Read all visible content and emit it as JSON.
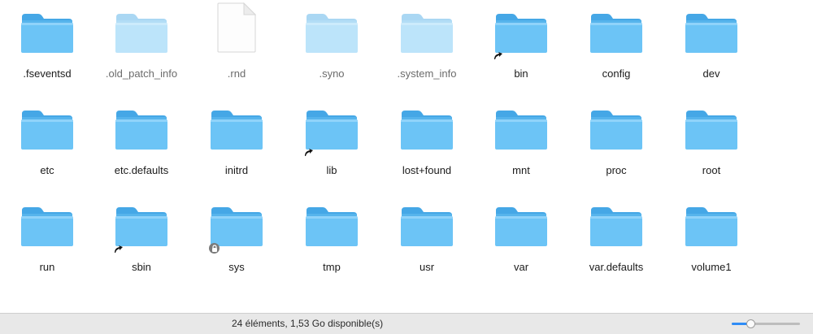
{
  "colors": {
    "folder_front": "#6cc4f6",
    "folder_back": "#56b4ec",
    "folder_tab": "#45a7e6",
    "dim_label": "#6b6b6b",
    "status_bg": "#e8e8e8",
    "accent": "#2f8cf6"
  },
  "items": [
    {
      "name": ".fseventsd",
      "icon": "folder-icon",
      "dimmed": false,
      "badge": null
    },
    {
      "name": ".old_patch_info",
      "icon": "folder-icon",
      "dimmed": true,
      "badge": null
    },
    {
      "name": ".rnd",
      "icon": "document-icon",
      "dimmed": true,
      "badge": null
    },
    {
      "name": ".syno",
      "icon": "folder-icon",
      "dimmed": true,
      "badge": null
    },
    {
      "name": ".system_info",
      "icon": "folder-icon",
      "dimmed": true,
      "badge": null
    },
    {
      "name": "bin",
      "icon": "folder-icon",
      "dimmed": false,
      "badge": "alias-arrow-icon"
    },
    {
      "name": "config",
      "icon": "folder-icon",
      "dimmed": false,
      "badge": null
    },
    {
      "name": "dev",
      "icon": "folder-icon",
      "dimmed": false,
      "badge": null
    },
    {
      "name": "etc",
      "icon": "folder-icon",
      "dimmed": false,
      "badge": null
    },
    {
      "name": "etc.defaults",
      "icon": "folder-icon",
      "dimmed": false,
      "badge": null
    },
    {
      "name": "initrd",
      "icon": "folder-icon",
      "dimmed": false,
      "badge": null
    },
    {
      "name": "lib",
      "icon": "folder-icon",
      "dimmed": false,
      "badge": "alias-arrow-icon"
    },
    {
      "name": "lost+found",
      "icon": "folder-icon",
      "dimmed": false,
      "badge": null
    },
    {
      "name": "mnt",
      "icon": "folder-icon",
      "dimmed": false,
      "badge": null
    },
    {
      "name": "proc",
      "icon": "folder-icon",
      "dimmed": false,
      "badge": null
    },
    {
      "name": "root",
      "icon": "folder-icon",
      "dimmed": false,
      "badge": null
    },
    {
      "name": "run",
      "icon": "folder-icon",
      "dimmed": false,
      "badge": null
    },
    {
      "name": "sbin",
      "icon": "folder-icon",
      "dimmed": false,
      "badge": "alias-arrow-icon"
    },
    {
      "name": "sys",
      "icon": "folder-icon",
      "dimmed": false,
      "badge": "lock-icon"
    },
    {
      "name": "tmp",
      "icon": "folder-icon",
      "dimmed": false,
      "badge": null
    },
    {
      "name": "usr",
      "icon": "folder-icon",
      "dimmed": false,
      "badge": null
    },
    {
      "name": "var",
      "icon": "folder-icon",
      "dimmed": false,
      "badge": null
    },
    {
      "name": "var.defaults",
      "icon": "folder-icon",
      "dimmed": false,
      "badge": null
    },
    {
      "name": "volume1",
      "icon": "folder-icon",
      "dimmed": false,
      "badge": null
    }
  ],
  "statusbar": {
    "text": "24 éléments, 1,53 Go disponible(s)",
    "zoom_level": 0.25
  }
}
